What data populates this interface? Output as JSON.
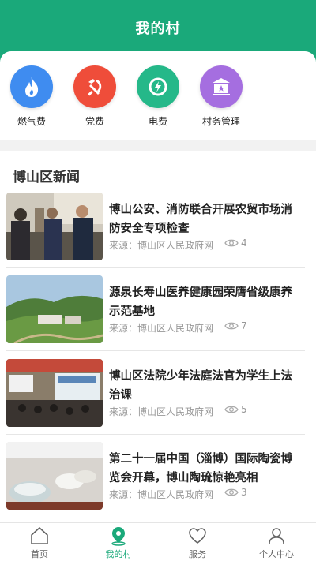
{
  "header": {
    "title": "我的村"
  },
  "services": [
    {
      "label": "燃气费",
      "icon": "flame-icon",
      "color": "#3f8cf0"
    },
    {
      "label": "党费",
      "icon": "party-emblem-icon",
      "color": "#ef4d3a"
    },
    {
      "label": "电费",
      "icon": "lightning-icon",
      "color": "#25b889"
    },
    {
      "label": "村务管理",
      "icon": "star-building-icon",
      "color": "#a56ee0"
    }
  ],
  "news": {
    "title": "博山区新闻",
    "items": [
      {
        "headline": "博山公安、消防联合开展农贸市场消防安全专项检查",
        "source": "来源：博山区人民政府网",
        "views": "4"
      },
      {
        "headline": "源泉长寿山医养健康园荣膺省级康养示范基地",
        "source": "来源：博山区人民政府网",
        "views": "7"
      },
      {
        "headline": "博山区法院少年法庭法官为学生上法治课",
        "source": "来源：博山区人民政府网",
        "views": "5"
      },
      {
        "headline": "第二十一届中国（淄博）国际陶瓷博览会开幕，博山陶琉惊艳亮相",
        "source": "来源：博山区人民政府网",
        "views": "3"
      }
    ]
  },
  "tabbar": {
    "tabs": [
      {
        "label": "首页",
        "icon": "home-icon"
      },
      {
        "label": "我的村",
        "icon": "location-pin-icon"
      },
      {
        "label": "服务",
        "icon": "heart-icon"
      },
      {
        "label": "个人中心",
        "icon": "person-icon"
      }
    ],
    "active_index": 1
  },
  "colors": {
    "primary": "#1aa97a"
  }
}
